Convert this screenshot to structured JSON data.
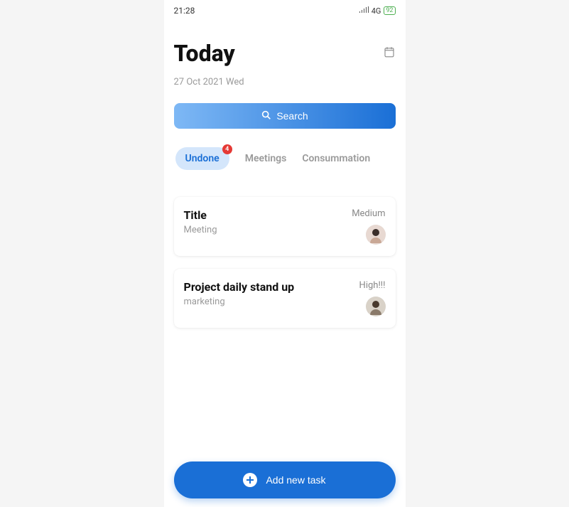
{
  "status": {
    "time": "21:28",
    "network": "4G",
    "battery": "92"
  },
  "header": {
    "title": "Today",
    "date": "27 Oct 2021 Wed"
  },
  "search": {
    "label": "Search"
  },
  "tabs": {
    "items": [
      {
        "label": "Undone",
        "badge": "4",
        "active": true
      },
      {
        "label": "Meetings",
        "active": false
      },
      {
        "label": "Consummation",
        "active": false
      }
    ]
  },
  "tasks": [
    {
      "title": "Title",
      "subtitle": "Meeting",
      "priority": "Medium"
    },
    {
      "title": "Project daily stand up",
      "subtitle": "marketing",
      "priority": "High!!!"
    }
  ],
  "fab": {
    "label": "Add new task"
  }
}
